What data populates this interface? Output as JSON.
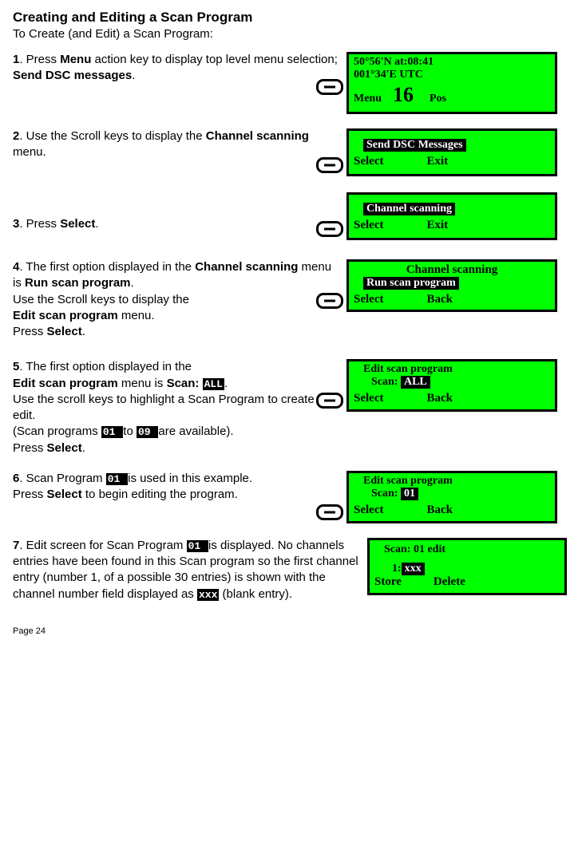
{
  "title": "Creating and Editing a Scan Program",
  "subtitle": "To Create (and Edit) a Scan Program:",
  "steps": {
    "s1": {
      "num": "1",
      "text_a": ". Press ",
      "bold_a": "Menu",
      "text_b": " action key to display top level menu selection; ",
      "bold_b": "Send DSC messages",
      "text_c": "."
    },
    "s2": {
      "num": "2",
      "text_a": ". Use the Scroll keys to display the ",
      "bold_a": "Channel scanning",
      "text_b": " menu."
    },
    "s3": {
      "num": "3",
      "text_a": ". Press ",
      "bold_a": "Select",
      "text_b": "."
    },
    "s4": {
      "num": "4",
      "text_a": ". The first option displayed in the ",
      "bold_a": "Channel scanning",
      "text_b": " menu is ",
      "bold_b": "Run scan program",
      "text_c": ".",
      "line2": "Use the Scroll keys to display the",
      "bold_c": "Edit scan program",
      "text_d": "  menu.",
      "line3a": "Press  ",
      "bold_d": "Select",
      "text_e": "."
    },
    "s5": {
      "num": "5",
      "text_a": ". The first option displayed in the ",
      "bold_a": "Edit scan program",
      "text_b": " menu is ",
      "bold_b": "Scan: ",
      "inv_a": "ALL",
      "text_c": ".",
      "line2": "Use the scroll keys to highlight a Scan Program to create or edit.",
      "line3a": "(Scan programs ",
      "inv_b": " 01 ",
      "line3b": " to ",
      "inv_c": " 09 ",
      "line3c": " are available).",
      "line4a": "Press ",
      "bold_c": "Select",
      "text_d": "."
    },
    "s6": {
      "num": "6",
      "text_a": ". Scan Program ",
      "inv_a": " 01 ",
      "text_b": " is used in this example.",
      "line2a": "Press ",
      "bold_a": "Select",
      "line2b": " to begin editing the program."
    },
    "s7": {
      "num": "7",
      "text_a": ". Edit screen for Scan Program ",
      "inv_a": " 01 ",
      "text_b": " is displayed. No channels entries have been found in this Scan program so the first channel entry (number 1, of a possible 30 entries) is shown with the channel number field displayed as ",
      "inv_b": "xxx",
      "text_c": "  (blank entry)."
    }
  },
  "screens": {
    "scr1": {
      "line1": "50°56'N       at:08:41",
      "line2": "001°34'E     UTC",
      "menu": "Menu",
      "big": "16",
      "pos": "Pos"
    },
    "scr2": {
      "highlight": "  Send DSC Messages    ",
      "left": "Select",
      "right": "Exit"
    },
    "scr3": {
      "highlight": "  Channel scanning      ",
      "left": "Select",
      "right": "Exit"
    },
    "scr4": {
      "title": "Channel scanning",
      "highlight": "  Run scan program  ",
      "left": "Select",
      "right": "Back"
    },
    "scr5": {
      "title": "Edit scan program",
      "scan_label": "Scan: ",
      "scan_val": "ALL",
      "left": "Select",
      "right": "Back"
    },
    "scr6": {
      "title": "Edit scan program",
      "scan_label": "Scan: ",
      "scan_val": "01",
      "left": "Select",
      "right": "Back"
    },
    "scr7": {
      "title": "Scan: 01 edit",
      "entry_prefix": "1:",
      "entry_val": "xxx",
      "left": "Store",
      "right": "Delete"
    }
  },
  "page": "Page 24"
}
